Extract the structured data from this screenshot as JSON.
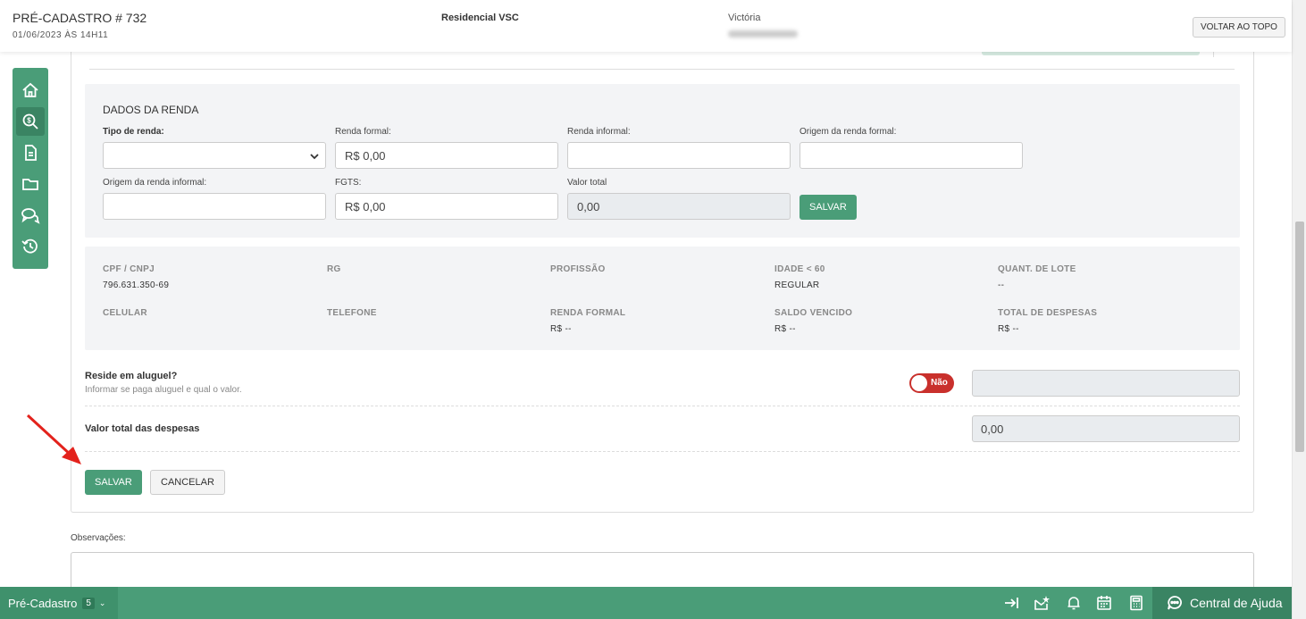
{
  "header": {
    "title": "PRÉ-CADASTRO # 732",
    "date": "01/06/2023 ÀS 14H11",
    "empreendimento": "Residencial VSC",
    "cliente": "Victória",
    "back_top_label": "VOLTAR AO TOPO"
  },
  "sidebar": {
    "icons": [
      "home-icon",
      "search-money-icon",
      "document-icon",
      "folder-icon",
      "chat-icon",
      "history-icon"
    ]
  },
  "renda": {
    "section_title": "DADOS DA RENDA",
    "tipo_renda_label": "Tipo de renda:",
    "tipo_renda_value": "",
    "renda_formal_label": "Renda formal:",
    "renda_formal_value": "R$ 0,00",
    "renda_informal_label": "Renda informal:",
    "renda_informal_value": "",
    "origem_formal_label": "Origem da renda formal:",
    "origem_formal_value": "",
    "origem_informal_label": "Origem da renda informal:",
    "origem_informal_value": "",
    "fgts_label": "FGTS:",
    "fgts_value": "R$ 0,00",
    "valor_total_label": "Valor total",
    "valor_total_value": "0,00",
    "save_label": "SALVAR"
  },
  "info": {
    "cpf_label": "CPF / CNPJ",
    "cpf_value": "796.631.350-69",
    "rg_label": "RG",
    "rg_value": "",
    "profissao_label": "PROFISSÃO",
    "profissao_value": "",
    "idade_label": "IDADE < 60",
    "idade_value": "REGULAR",
    "lote_label": "QUANT. DE LOTE",
    "lote_value": "--",
    "celular_label": "CELULAR",
    "celular_value": "",
    "telefone_label": "TELEFONE",
    "telefone_value": "",
    "renda_formal_label": "RENDA FORMAL",
    "renda_formal_value": "R$ --",
    "saldo_label": "SALDO VENCIDO",
    "saldo_value": "R$ --",
    "despesas_label": "TOTAL DE DESPESAS",
    "despesas_value": "R$ --"
  },
  "aluguel": {
    "title": "Reside em aluguel?",
    "subtitle": "Informar se paga aluguel e qual o valor.",
    "toggle_label": "Não",
    "value": ""
  },
  "despesas": {
    "title": "Valor total das despesas",
    "value": "0,00"
  },
  "actions": {
    "save_label": "SALVAR",
    "cancel_label": "CANCELAR"
  },
  "observacoes": {
    "label": "Observações:"
  },
  "footer": {
    "module_label": "Pré-Cadastro",
    "badge_count": "5",
    "help_label": "Central de Ajuda"
  },
  "colors": {
    "primary_green": "#4a9d78",
    "toggle_red": "#c9302c",
    "arrow_red": "#e3221c"
  }
}
